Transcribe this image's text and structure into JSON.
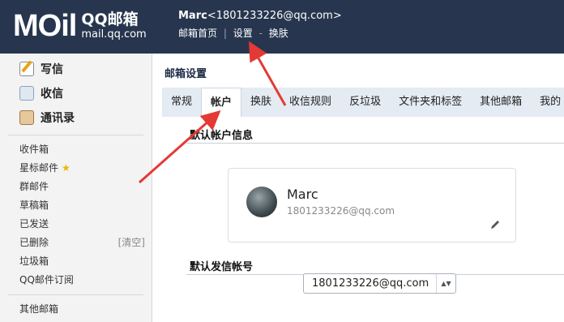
{
  "header": {
    "logo_mail": "MOil",
    "logo_cn": "QQ邮箱",
    "logo_url": "mail.qq.com",
    "user_name": "Marc",
    "user_email": "<1801233226@qq.com>",
    "nav_home": "邮箱首页",
    "nav_sep": "|",
    "nav_settings": "设置",
    "nav_dash": "-",
    "nav_skin": "换肤"
  },
  "sidebar": {
    "actions": [
      {
        "label": "写信",
        "icon": "pencil-icon"
      },
      {
        "label": "收信",
        "icon": "inbox-icon"
      },
      {
        "label": "通讯录",
        "icon": "contacts-icon"
      }
    ],
    "folders": [
      {
        "label": "收件箱"
      },
      {
        "label": "星标邮件",
        "star": "★"
      },
      {
        "label": "群邮件"
      },
      {
        "label": "草稿箱"
      },
      {
        "label": "已发送"
      },
      {
        "label": "已删除",
        "extra": "[清空]"
      },
      {
        "label": "垃圾箱"
      },
      {
        "label": "QQ邮件订阅"
      }
    ],
    "other": "其他邮箱"
  },
  "main": {
    "title": "邮箱设置",
    "tabs": [
      "常规",
      "帐户",
      "换肤",
      "收信规则",
      "反垃圾",
      "文件夹和标签",
      "其他邮箱",
      "我的"
    ],
    "active_tab": "帐户",
    "section1": "默认帐户信息",
    "account_name": "Marc",
    "account_email": "1801233226@qq.com",
    "section2": "默认发信帐号",
    "sender_select": "1801233226@qq.com",
    "select_arrow": "▲▼"
  },
  "colors": {
    "header_bg": "#27364e",
    "tab_bar_bg": "#e4ebf3",
    "arrow_red": "#e53935"
  }
}
